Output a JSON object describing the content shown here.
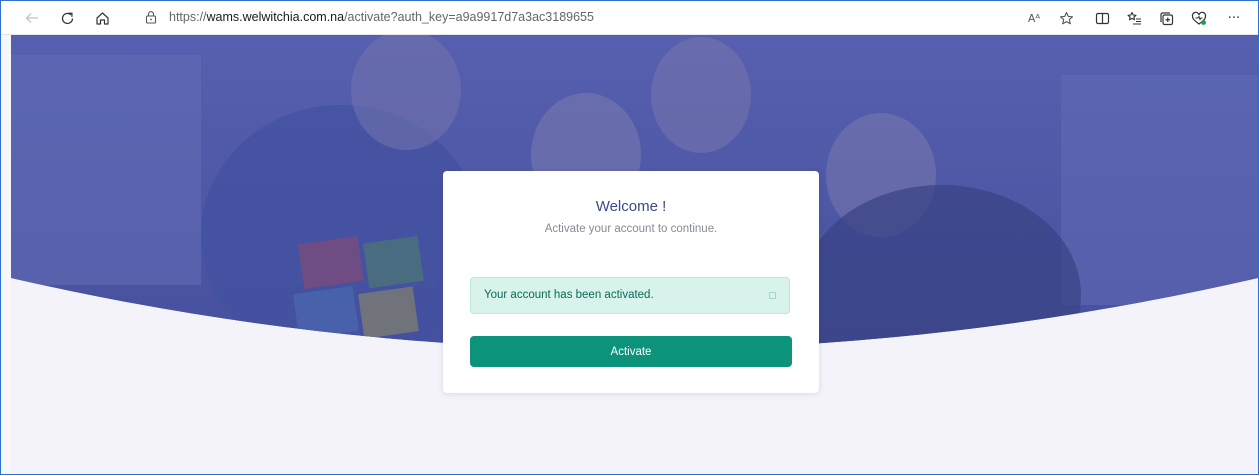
{
  "browser": {
    "url_prefix": "https://",
    "url_host": "wams.welwitchia.com.na",
    "url_path": "/activate?auth_key=a9a9917d7a3ac3189655",
    "toolbar_icons": [
      "back-icon",
      "refresh-icon",
      "home-icon",
      "lock-icon",
      "read-aloud-icon",
      "favorite-star-icon",
      "split-screen-icon",
      "favorites-list-icon",
      "collections-icon",
      "browser-essentials-icon",
      "more-icon"
    ],
    "read_aloud_glyph": "Aᴬ",
    "more_glyph": "···"
  },
  "card": {
    "title": "Welcome !",
    "subtitle": "Activate your account to continue.",
    "alert_text": "Your account has been activated.",
    "button_label": "Activate"
  },
  "colors": {
    "hero_overlay": "#4a55a2",
    "alert_bg": "#d8f2ec",
    "alert_text": "#0a6b59",
    "button_bg": "#0c937c",
    "title": "#3d4a86",
    "page_bg": "#f3f3f9",
    "frame_border": "#2f6fcf"
  }
}
